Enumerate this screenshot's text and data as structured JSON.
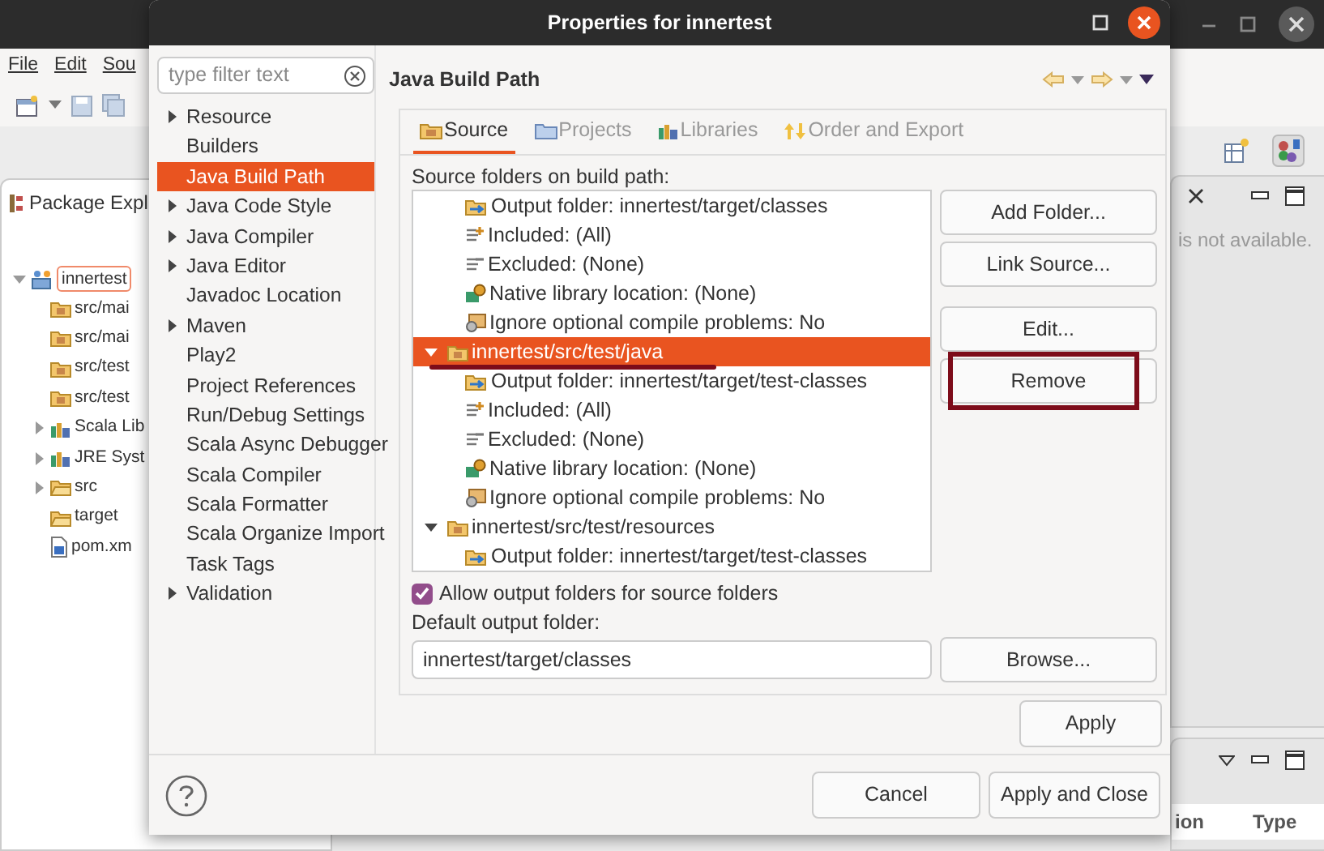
{
  "app": {
    "menu": [
      {
        "label": "File"
      },
      {
        "label": "Edit"
      },
      {
        "label": "Sou"
      }
    ],
    "explorer": {
      "title": "Package Expl",
      "items": [
        {
          "label": "innertest",
          "kind": "project",
          "expanded": true,
          "selected": true,
          "children": [
            {
              "label": "src/mai",
              "kind": "source",
              "selected": false
            },
            {
              "label": "src/mai",
              "kind": "source",
              "selected": false
            },
            {
              "label": "src/test",
              "kind": "source",
              "selected": false
            },
            {
              "label": "src/test",
              "kind": "source",
              "selected": false
            },
            {
              "label": "Scala Lib",
              "kind": "library",
              "expanded": false,
              "selected": false
            },
            {
              "label": "JRE Syst",
              "kind": "library",
              "expanded": false,
              "selected": false
            },
            {
              "label": "src",
              "kind": "folder",
              "expanded": false,
              "selected": false
            },
            {
              "label": "target",
              "kind": "folder",
              "selected": false
            },
            {
              "label": "pom.xm",
              "kind": "file",
              "selected": false
            }
          ]
        }
      ]
    },
    "editor_view": {
      "message": "is not available."
    },
    "bottom_view": {
      "columns": [
        "ion",
        "Type"
      ]
    }
  },
  "dialog": {
    "title": "Properties for innertest",
    "filter": {
      "placeholder": "type filter text"
    },
    "categories": [
      {
        "label": "Resource",
        "expanded": false,
        "selected": false
      },
      {
        "label": "Builders",
        "selected": false
      },
      {
        "label": "Java Build Path",
        "selected": true
      },
      {
        "label": "Java Code Style",
        "expanded": false,
        "selected": false
      },
      {
        "label": "Java Compiler",
        "expanded": false,
        "selected": false
      },
      {
        "label": "Java Editor",
        "expanded": false,
        "selected": false
      },
      {
        "label": "Javadoc Location",
        "selected": false
      },
      {
        "label": "Maven",
        "expanded": false,
        "selected": false
      },
      {
        "label": "Play2",
        "selected": false
      },
      {
        "label": "Project References",
        "selected": false
      },
      {
        "label": "Run/Debug Settings",
        "selected": false
      },
      {
        "label": "Scala Async Debugger",
        "selected": false
      },
      {
        "label": "Scala Compiler",
        "selected": false
      },
      {
        "label": "Scala Formatter",
        "selected": false
      },
      {
        "label": "Scala Organize Import",
        "selected": false
      },
      {
        "label": "Task Tags",
        "selected": false
      },
      {
        "label": "Validation",
        "expanded": false,
        "selected": false
      }
    ],
    "page_title": "Java Build Path",
    "tabs": [
      {
        "label": "Source",
        "kind": "source",
        "selected": true
      },
      {
        "label": "Projects",
        "kind": "projects",
        "selected": false
      },
      {
        "label": "Libraries",
        "kind": "libraries",
        "selected": false
      },
      {
        "label": "Order and Export",
        "kind": "order",
        "selected": false
      }
    ],
    "source_label": "Source folders on build path:",
    "source_tree": {
      "scrolled_rows": [
        {
          "label": "Output folder: innertest/target/classes",
          "kind": "output"
        },
        {
          "label": "Included: (All)",
          "kind": "included"
        },
        {
          "label": "Excluded: (None)",
          "kind": "excluded"
        },
        {
          "label": "Native library location: (None)",
          "kind": "native"
        },
        {
          "label": "Ignore optional compile problems: No",
          "kind": "ignore"
        }
      ],
      "folders": [
        {
          "label": "innertest/src/test/java",
          "expanded": true,
          "selected": true,
          "children": [
            {
              "label": "Output folder: innertest/target/test-classes",
              "kind": "output"
            },
            {
              "label": "Included: (All)",
              "kind": "included"
            },
            {
              "label": "Excluded: (None)",
              "kind": "excluded"
            },
            {
              "label": "Native library location: (None)",
              "kind": "native"
            },
            {
              "label": "Ignore optional compile problems: No",
              "kind": "ignore"
            }
          ]
        },
        {
          "label": "innertest/src/test/resources",
          "expanded": true,
          "selected": false,
          "children": [
            {
              "label": "Output folder: innertest/target/test-classes",
              "kind": "output"
            }
          ]
        }
      ]
    },
    "side_button_groups": [
      [
        "Add Folder...",
        "Link Source..."
      ],
      [
        "Edit...",
        "Remove"
      ]
    ],
    "allow_output": {
      "label": "Allow output folders for source folders",
      "checked": true
    },
    "default_output": {
      "label": "Default output folder:",
      "value": "innertest/target/classes"
    },
    "browse": "Browse...",
    "apply": "Apply",
    "footer_buttons": [
      "Cancel",
      "Apply and Close"
    ]
  }
}
